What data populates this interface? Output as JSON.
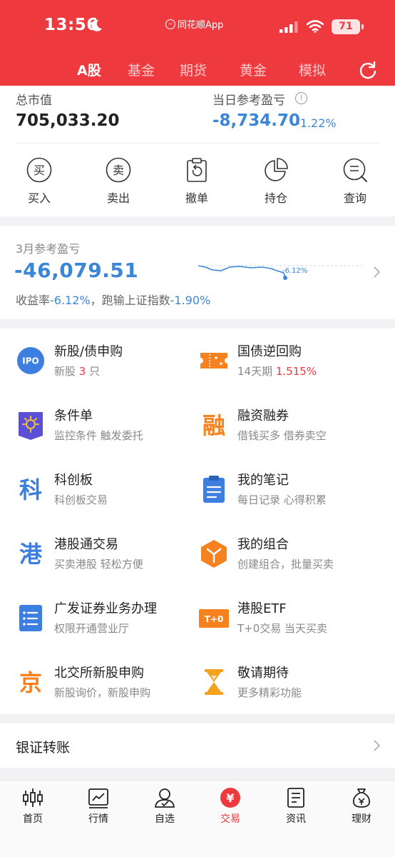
{
  "status_bar": {
    "time": "13:56",
    "carrier": "同花顺App",
    "battery": "71"
  },
  "tabs": [
    {
      "label": "A股",
      "active": true
    },
    {
      "label": "基金"
    },
    {
      "label": "期货"
    },
    {
      "label": "黄金"
    },
    {
      "label": "模拟"
    }
  ],
  "assets": {
    "total_label": "总市值",
    "total_value": "705,033.20",
    "day_label": "当日参考盈亏",
    "day_value": "-8,734.70",
    "day_pct": "-1.22%",
    "info_icon": "i"
  },
  "actions": [
    {
      "label": "买入",
      "icon": "buy-icon",
      "glyph": "买"
    },
    {
      "label": "卖出",
      "icon": "sell-icon",
      "glyph": "卖"
    },
    {
      "label": "撤单",
      "icon": "cancel-order-icon"
    },
    {
      "label": "持仓",
      "icon": "pie-chart-icon"
    },
    {
      "label": "查询",
      "icon": "query-icon"
    }
  ],
  "monthly": {
    "label": "3月参考盈亏",
    "value": "-46,079.51",
    "sub_prefix": "收益率",
    "sub_pct": "-6.12%",
    "sub_middle": "，跑输上证指数",
    "sub_index": "-1.90%",
    "spark_label": "-6.12%"
  },
  "services": [
    {
      "title": "新股/债申购",
      "sub_prefix": "新股 ",
      "sub_highlight": "3",
      "sub_suffix": " 只",
      "icon": "ipo-icon",
      "icon_text": "IPO"
    },
    {
      "title": "国债逆回购",
      "sub_prefix": "14天期 ",
      "sub_highlight": "1.515%",
      "sub_suffix": "",
      "icon": "ticket-icon"
    },
    {
      "title": "条件单",
      "sub": "监控条件 触发委托",
      "icon": "condition-order-icon"
    },
    {
      "title": "融资融券",
      "sub": "借钱买多 借券卖空",
      "icon": "margin-icon",
      "icon_text": "融"
    },
    {
      "title": "科创板",
      "sub": "科创板交易",
      "icon": "star-market-icon",
      "icon_text": "科"
    },
    {
      "title": "我的笔记",
      "sub": "每日记录 心得积累",
      "icon": "notes-icon"
    },
    {
      "title": "港股通交易",
      "sub": "买卖港股 轻松方便",
      "icon": "hk-connect-icon",
      "icon_text": "港"
    },
    {
      "title": "我的组合",
      "sub": "创建组合，批量买卖",
      "icon": "portfolio-icon"
    },
    {
      "title": "广发证券业务办理",
      "sub": "权限开通营业厅",
      "icon": "business-list-icon"
    },
    {
      "title": "港股ETF",
      "sub": "T+0交易 当天买卖",
      "icon": "t0-icon",
      "icon_text": "T+0"
    },
    {
      "title": "北交所新股申购",
      "sub": "新股询价，新股申购",
      "icon": "bse-icon",
      "icon_text": "京"
    },
    {
      "title": "敬请期待",
      "sub": "更多精彩功能",
      "icon": "hourglass-icon"
    }
  ],
  "bank": {
    "label": "银证转账"
  },
  "bottom_nav": [
    {
      "label": "首页",
      "icon": "candlestick-icon"
    },
    {
      "label": "行情",
      "icon": "chart-icon"
    },
    {
      "label": "自选",
      "icon": "user-select-icon"
    },
    {
      "label": "交易",
      "icon": "trade-icon",
      "active": true,
      "glyph": "¥"
    },
    {
      "label": "资讯",
      "icon": "news-icon"
    },
    {
      "label": "理财",
      "icon": "wealth-icon"
    }
  ],
  "colors": {
    "brand_red": "#ee3a3f",
    "loss_blue": "#3a86d8",
    "highlight_red": "#e8383d",
    "ipo_blue": "#3d7fe0",
    "orange": "#f5821f",
    "purple": "#5b4fd6"
  }
}
